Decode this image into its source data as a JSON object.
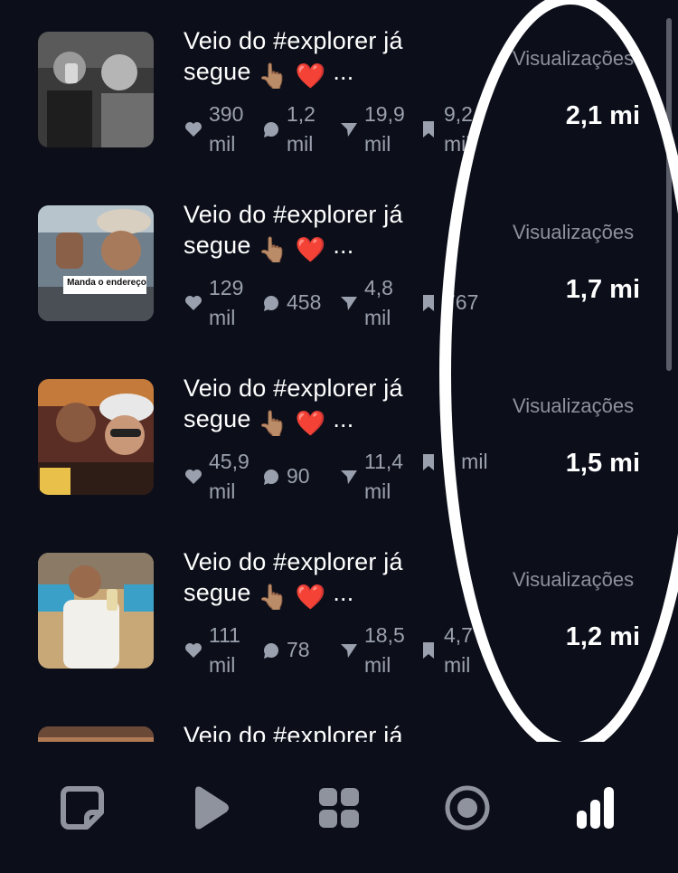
{
  "posts": [
    {
      "title_line1": "Veio do #explorer já",
      "title_line2": "segue 👆🏽 ❤️ ...",
      "likes": "390 mil",
      "comments": "1,2 mil",
      "shares": "19,9 mil",
      "saves": "9,2 mil",
      "views_label": "Visualizações",
      "views_value": "2,1 mi"
    },
    {
      "title_line1": "Veio do #explorer já",
      "title_line2": "segue 👆🏽 ❤️ ...",
      "likes": "129 mil",
      "comments": "458",
      "shares": "4,8 mil",
      "saves": "767",
      "views_label": "Visualizações",
      "views_value": "1,7 mi",
      "thumb_caption": "Manda o endereço"
    },
    {
      "title_line1": "Veio do #explorer já",
      "title_line2": "segue 👆🏽 ❤️ ...",
      "likes": "45,9 mil",
      "comments": "90",
      "shares": "11,4 mil",
      "saves": "3 mil",
      "views_label": "Visualizações",
      "views_value": "1,5 mi"
    },
    {
      "title_line1": "Veio do #explorer já",
      "title_line2": "segue 👆🏽 ❤️ ...",
      "likes": "111 mil",
      "comments": "78",
      "shares": "18,5 mil",
      "saves": "4,7 mil",
      "views_label": "Visualizações",
      "views_value": "1,2 mi"
    },
    {
      "title_line1": "Veio do #explorer já",
      "title_line2": ""
    }
  ],
  "tabs": [
    {
      "icon": "note-icon",
      "active": false
    },
    {
      "icon": "play-icon",
      "active": false
    },
    {
      "icon": "grid-icon",
      "active": false
    },
    {
      "icon": "target-icon",
      "active": false
    },
    {
      "icon": "bar-chart-icon",
      "active": true
    }
  ],
  "colors": {
    "background": "#0c0f1a",
    "muted_text": "#9aa0ad",
    "icon_inactive": "#8e939e",
    "icon_active": "#ffffff",
    "annotation": "#ffffff"
  }
}
